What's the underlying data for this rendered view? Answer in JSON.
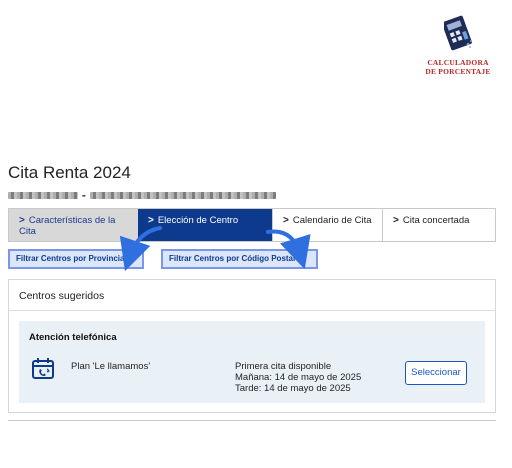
{
  "logo": {
    "line1": "CALCULADORA",
    "line2": "DE PORCENTAJE"
  },
  "page": {
    "title": "Cita Renta 2024",
    "subtitle_separator": "-"
  },
  "stepper": {
    "steps": [
      {
        "label": "Características de la Cita",
        "state": "completed"
      },
      {
        "label": "Elección de Centro",
        "state": "active"
      },
      {
        "label": "Calendario de Cita",
        "state": "pending"
      },
      {
        "label": "Cita concertada",
        "state": "pending"
      }
    ]
  },
  "filters": {
    "province_label": "Filtrar Centros por Provincia",
    "postal_label": "Filtrar Centros por Código Postal"
  },
  "card": {
    "header": "Centros sugeridos",
    "panel": {
      "title": "Atención telefónica",
      "plan": "Plan 'Le llamamos'",
      "availability_title": "Primera cita disponible",
      "morning": "Mañana: 14 de mayo de 2025",
      "afternoon": "Tarde: 14 de mayo de 2025",
      "select_label": "Seleccionar"
    }
  },
  "colors": {
    "primary": "#0e3a8e",
    "accent_border": "#7b96e6",
    "panel_bg": "#eaf1f6",
    "logo_red": "#b52a2a"
  },
  "icons": {
    "logo": "calculator-logo-icon",
    "step_chevron": "chevron-right-icon",
    "filter_chevron": "chevron-down-icon",
    "phone": "phone-calendar-icon"
  }
}
